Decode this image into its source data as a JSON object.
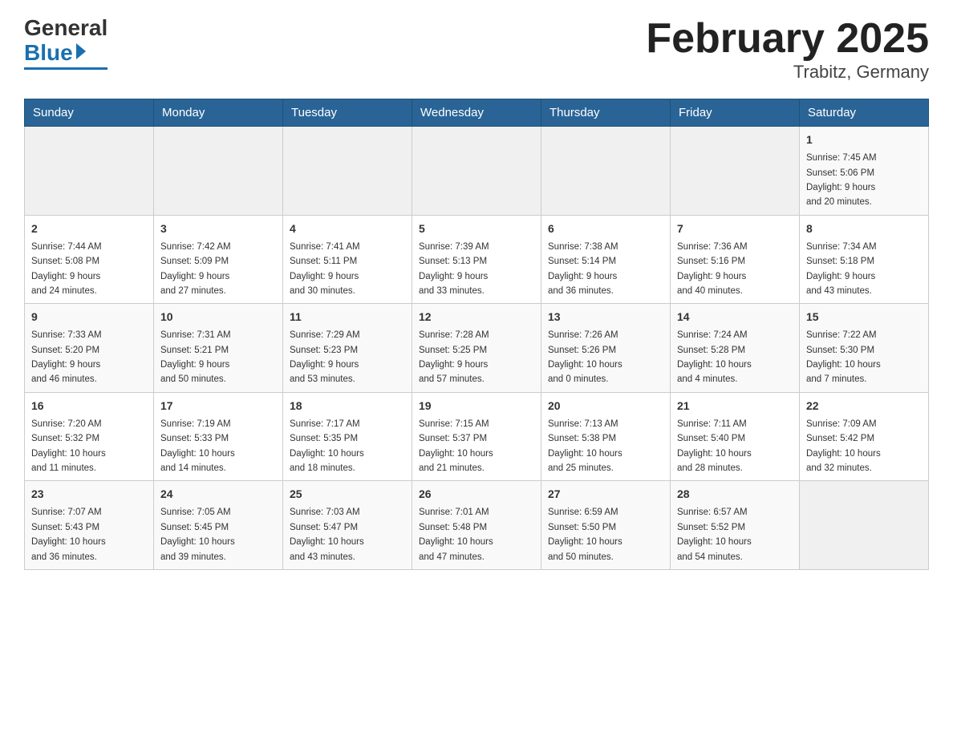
{
  "header": {
    "logo_general": "General",
    "logo_blue": "Blue",
    "title": "February 2025",
    "subtitle": "Trabitz, Germany"
  },
  "days_header": [
    "Sunday",
    "Monday",
    "Tuesday",
    "Wednesday",
    "Thursday",
    "Friday",
    "Saturday"
  ],
  "weeks": [
    {
      "days": [
        {
          "num": "",
          "info": ""
        },
        {
          "num": "",
          "info": ""
        },
        {
          "num": "",
          "info": ""
        },
        {
          "num": "",
          "info": ""
        },
        {
          "num": "",
          "info": ""
        },
        {
          "num": "",
          "info": ""
        },
        {
          "num": "1",
          "info": "Sunrise: 7:45 AM\nSunset: 5:06 PM\nDaylight: 9 hours\nand 20 minutes."
        }
      ]
    },
    {
      "days": [
        {
          "num": "2",
          "info": "Sunrise: 7:44 AM\nSunset: 5:08 PM\nDaylight: 9 hours\nand 24 minutes."
        },
        {
          "num": "3",
          "info": "Sunrise: 7:42 AM\nSunset: 5:09 PM\nDaylight: 9 hours\nand 27 minutes."
        },
        {
          "num": "4",
          "info": "Sunrise: 7:41 AM\nSunset: 5:11 PM\nDaylight: 9 hours\nand 30 minutes."
        },
        {
          "num": "5",
          "info": "Sunrise: 7:39 AM\nSunset: 5:13 PM\nDaylight: 9 hours\nand 33 minutes."
        },
        {
          "num": "6",
          "info": "Sunrise: 7:38 AM\nSunset: 5:14 PM\nDaylight: 9 hours\nand 36 minutes."
        },
        {
          "num": "7",
          "info": "Sunrise: 7:36 AM\nSunset: 5:16 PM\nDaylight: 9 hours\nand 40 minutes."
        },
        {
          "num": "8",
          "info": "Sunrise: 7:34 AM\nSunset: 5:18 PM\nDaylight: 9 hours\nand 43 minutes."
        }
      ]
    },
    {
      "days": [
        {
          "num": "9",
          "info": "Sunrise: 7:33 AM\nSunset: 5:20 PM\nDaylight: 9 hours\nand 46 minutes."
        },
        {
          "num": "10",
          "info": "Sunrise: 7:31 AM\nSunset: 5:21 PM\nDaylight: 9 hours\nand 50 minutes."
        },
        {
          "num": "11",
          "info": "Sunrise: 7:29 AM\nSunset: 5:23 PM\nDaylight: 9 hours\nand 53 minutes."
        },
        {
          "num": "12",
          "info": "Sunrise: 7:28 AM\nSunset: 5:25 PM\nDaylight: 9 hours\nand 57 minutes."
        },
        {
          "num": "13",
          "info": "Sunrise: 7:26 AM\nSunset: 5:26 PM\nDaylight: 10 hours\nand 0 minutes."
        },
        {
          "num": "14",
          "info": "Sunrise: 7:24 AM\nSunset: 5:28 PM\nDaylight: 10 hours\nand 4 minutes."
        },
        {
          "num": "15",
          "info": "Sunrise: 7:22 AM\nSunset: 5:30 PM\nDaylight: 10 hours\nand 7 minutes."
        }
      ]
    },
    {
      "days": [
        {
          "num": "16",
          "info": "Sunrise: 7:20 AM\nSunset: 5:32 PM\nDaylight: 10 hours\nand 11 minutes."
        },
        {
          "num": "17",
          "info": "Sunrise: 7:19 AM\nSunset: 5:33 PM\nDaylight: 10 hours\nand 14 minutes."
        },
        {
          "num": "18",
          "info": "Sunrise: 7:17 AM\nSunset: 5:35 PM\nDaylight: 10 hours\nand 18 minutes."
        },
        {
          "num": "19",
          "info": "Sunrise: 7:15 AM\nSunset: 5:37 PM\nDaylight: 10 hours\nand 21 minutes."
        },
        {
          "num": "20",
          "info": "Sunrise: 7:13 AM\nSunset: 5:38 PM\nDaylight: 10 hours\nand 25 minutes."
        },
        {
          "num": "21",
          "info": "Sunrise: 7:11 AM\nSunset: 5:40 PM\nDaylight: 10 hours\nand 28 minutes."
        },
        {
          "num": "22",
          "info": "Sunrise: 7:09 AM\nSunset: 5:42 PM\nDaylight: 10 hours\nand 32 minutes."
        }
      ]
    },
    {
      "days": [
        {
          "num": "23",
          "info": "Sunrise: 7:07 AM\nSunset: 5:43 PM\nDaylight: 10 hours\nand 36 minutes."
        },
        {
          "num": "24",
          "info": "Sunrise: 7:05 AM\nSunset: 5:45 PM\nDaylight: 10 hours\nand 39 minutes."
        },
        {
          "num": "25",
          "info": "Sunrise: 7:03 AM\nSunset: 5:47 PM\nDaylight: 10 hours\nand 43 minutes."
        },
        {
          "num": "26",
          "info": "Sunrise: 7:01 AM\nSunset: 5:48 PM\nDaylight: 10 hours\nand 47 minutes."
        },
        {
          "num": "27",
          "info": "Sunrise: 6:59 AM\nSunset: 5:50 PM\nDaylight: 10 hours\nand 50 minutes."
        },
        {
          "num": "28",
          "info": "Sunrise: 6:57 AM\nSunset: 5:52 PM\nDaylight: 10 hours\nand 54 minutes."
        },
        {
          "num": "",
          "info": ""
        }
      ]
    }
  ]
}
